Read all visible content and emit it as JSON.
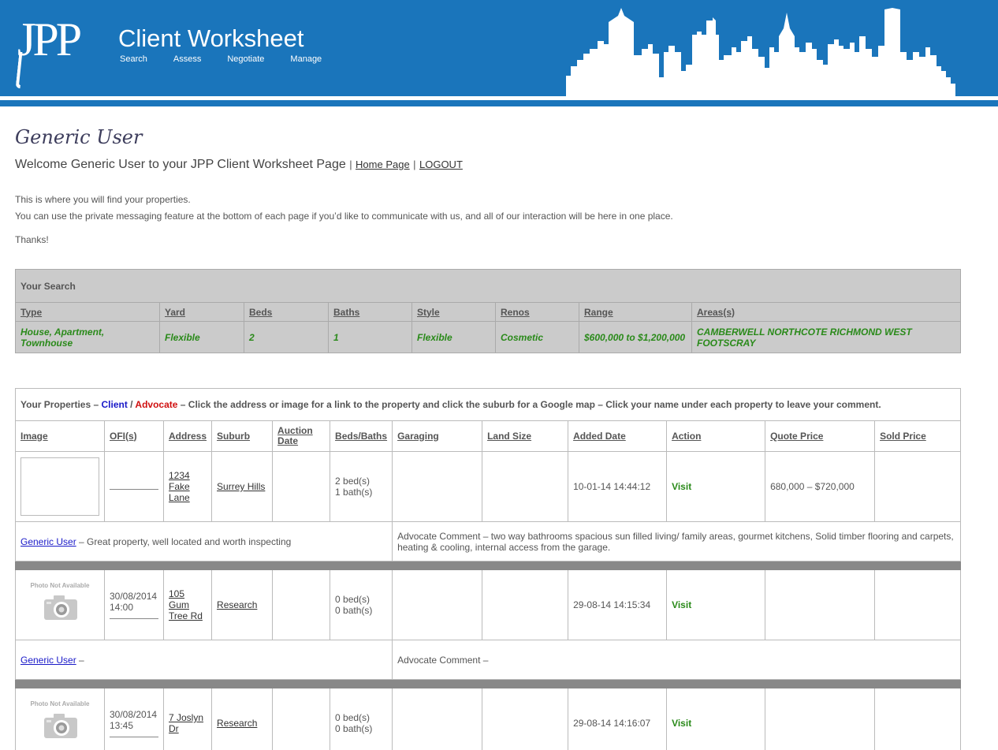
{
  "header": {
    "logo": "JPP",
    "title": "Client Worksheet",
    "nav": [
      "Search",
      "Assess",
      "Negotiate",
      "Manage"
    ]
  },
  "page": {
    "user_name": "Generic User",
    "welcome_text": "Welcome Generic User to your JPP Client Worksheet Page",
    "separator": "|",
    "home_link": "Home Page",
    "logout_link": "LOGOUT",
    "intro_1": "This is where you will find your properties.",
    "intro_2": "You can use the private messaging feature at the bottom of each page if you’d like to communicate with us, and all of our interaction will be here in one place.",
    "thanks": "Thanks!"
  },
  "search": {
    "caption": "Your Search",
    "headers": [
      "Type",
      "Yard",
      "Beds",
      "Baths",
      "Style",
      "Renos",
      "Range",
      "Areas(s)"
    ],
    "values": [
      "House, Apartment, Townhouse",
      "Flexible",
      "2",
      "1",
      "Flexible",
      "Cosmetic",
      "$600,000 to $1,200,000",
      "CAMBERWELL NORTHCOTE RICHMOND WEST FOOTSCRAY"
    ]
  },
  "properties": {
    "caption_prefix": "Your Properties –",
    "caption_client": "Client",
    "caption_slash": "/",
    "caption_advocate": "Advocate",
    "caption_suffix": "– Click the address or image for a link to the property and click the suburb for a Google map – Click your name under each property to leave your comment.",
    "headers": [
      "Image",
      "OFI(s)",
      "Address",
      "Suburb",
      "Auction Date",
      "Beds/Baths",
      "Garaging",
      "Land Size",
      "Added Date",
      "Action",
      "Quote Price",
      "Sold Price"
    ],
    "photo_na": "Photo Not Available",
    "rows": [
      {
        "ofi": "",
        "address": "1234 Fake Lane",
        "suburb": "Surrey Hills",
        "auction": "",
        "beds": "2 bed(s)",
        "baths": "1 bath(s)",
        "garaging": "",
        "land": "",
        "added": "10-01-14 14:44:12",
        "action": "Visit",
        "quote": "680,000 – $720,000",
        "sold": "",
        "client_name": "Generic User",
        "client_comment": "– Great property, well located and worth inspecting",
        "advocate_comment": "Advocate Comment – two way bathrooms spacious sun filled living/ family areas, gourmet kitchens, Solid timber flooring and carpets, heating & cooling, internal access from the garage."
      },
      {
        "ofi_date": "30/08/2014",
        "ofi_time": "14:00",
        "address": "105 Gum Tree Rd",
        "suburb": "Research",
        "auction": "",
        "beds": "0 bed(s)",
        "baths": "0 bath(s)",
        "garaging": "",
        "land": "",
        "added": "29-08-14 14:15:34",
        "action": "Visit",
        "quote": "",
        "sold": "",
        "client_name": "Generic User",
        "client_comment": "–",
        "advocate_comment": "Advocate Comment –"
      },
      {
        "ofi_date": "30/08/2014",
        "ofi_time": "13:45",
        "address": "7 Joslyn Dr",
        "suburb": "Research",
        "auction": "",
        "beds": "0 bed(s)",
        "baths": "0 bath(s)",
        "garaging": "",
        "land": "",
        "added": "29-08-14 14:16:07",
        "action": "Visit",
        "quote": "",
        "sold": ""
      }
    ]
  }
}
